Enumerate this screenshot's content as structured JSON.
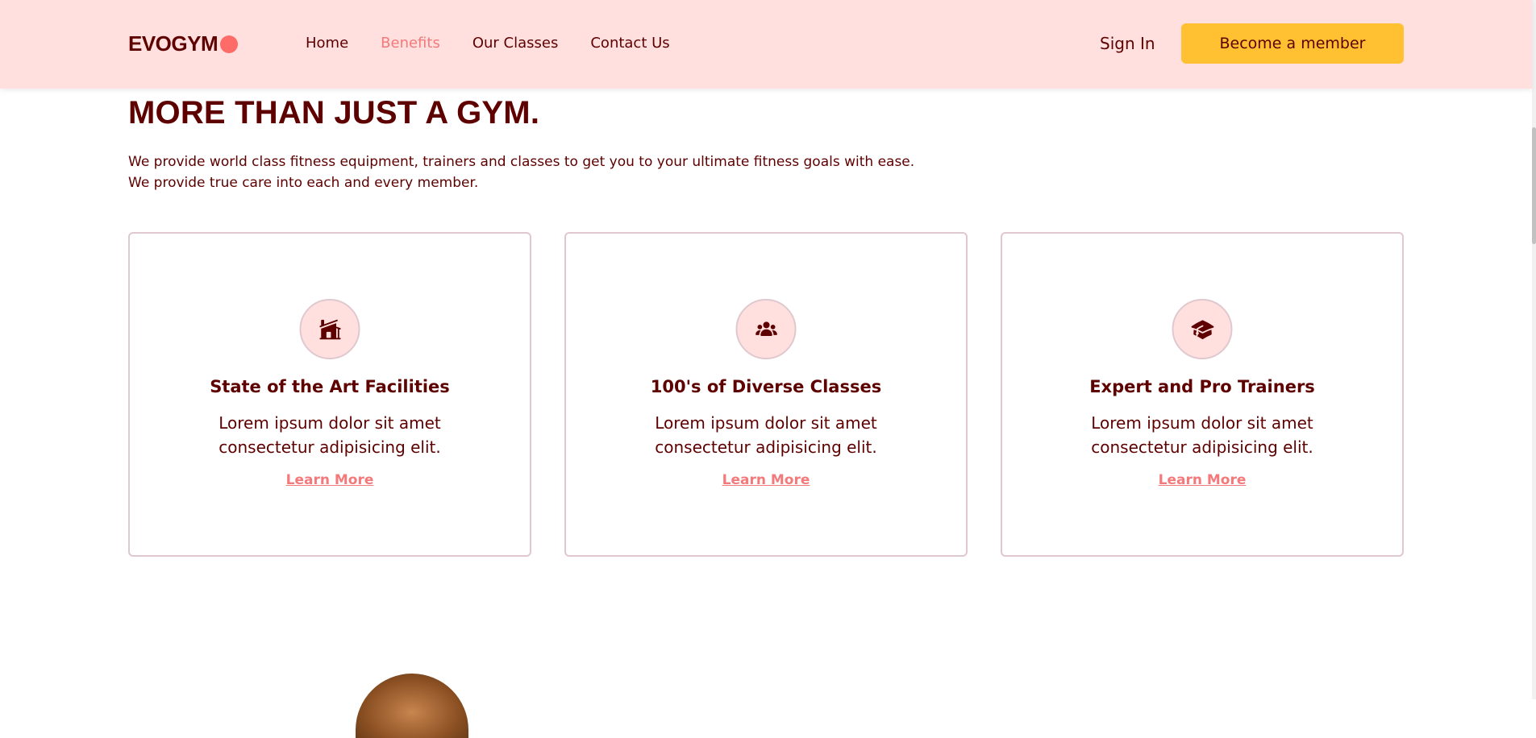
{
  "nav": {
    "logo": "EVOGYM",
    "links": [
      {
        "label": "Home"
      },
      {
        "label": "Benefits"
      },
      {
        "label": "Our Classes"
      },
      {
        "label": "Contact Us"
      }
    ],
    "active_link": "Benefits",
    "signin": "Sign In",
    "cta": "Become a member"
  },
  "colors": {
    "nav_bg": "#ffe0df",
    "primary_text": "#5e0000",
    "accent": "#f4797a",
    "logo_dot": "#ff6b66",
    "cta_bg": "#ffc132",
    "card_border": "#e0c8cf"
  },
  "section": {
    "title": "MORE THAN JUST A GYM.",
    "description_line1": "We provide world class fitness equipment, trainers and classes to get you to your ultimate fitness goals with ease.",
    "description_line2": "We provide true care into each and every member."
  },
  "cards": [
    {
      "icon": "home-modern-icon",
      "title": "State of the Art Facilities",
      "description": "Lorem ipsum dolor sit amet consectetur adipisicing elit.",
      "link": "Learn More"
    },
    {
      "icon": "user-group-icon",
      "title": "100's of Diverse Classes",
      "description": "Lorem ipsum dolor sit amet consectetur adipisicing elit.",
      "link": "Learn More"
    },
    {
      "icon": "academic-cap-icon",
      "title": "Expert and Pro Trainers",
      "description": "Lorem ipsum dolor sit amet consectetur adipisicing elit.",
      "link": "Learn More"
    }
  ]
}
